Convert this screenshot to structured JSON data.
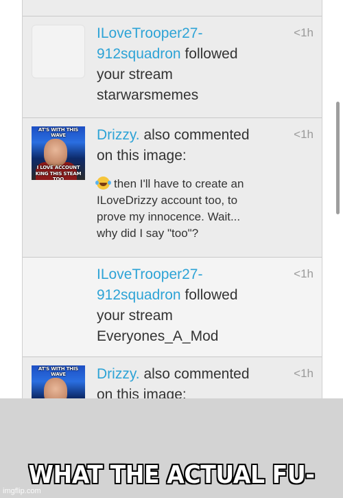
{
  "feed": {
    "items": [
      {
        "type": "follow",
        "user": "ILoveTrooper27-912squadron",
        "user_line1": "ILoveTrooper27-",
        "user_line2": "912squadron",
        "action": "followed",
        "line3": "your stream",
        "stream": "starwarsmemes",
        "time": "<1h",
        "thumbnail": "blank-avatar"
      },
      {
        "type": "comment",
        "user": "Drizzy.",
        "action_line1": "also commented",
        "action_line2": "on this image:",
        "comment_line1": "then I'll have to create an",
        "comment_line2": "ILoveDrizzy account too, to",
        "comment_line3": "prove my innocence. Wait...",
        "comment_line4": "why did I say \"too\"?",
        "emoji": "face-with-tears-of-joy",
        "time": "<1h",
        "thumbnail_caption_top": "AT'S WITH THIS WAVE",
        "thumbnail_caption_bottom1": "I LOVE      ACCOUNT",
        "thumbnail_caption_bottom2": "KING THIS STEAM TOO"
      },
      {
        "type": "follow",
        "user_line1": "ILoveTrooper27-",
        "user_line2": "912squadron",
        "action": "followed",
        "line3": "your stream",
        "stream": "Everyones_A_Mod",
        "time": "<1h"
      },
      {
        "type": "comment",
        "user": "Drizzy.",
        "action_line1": "also commented",
        "action_line2": "on this image:",
        "time": "<1h",
        "thumbnail_caption_top": "AT'S WITH THIS WAVE"
      }
    ]
  },
  "meme": {
    "caption": "WHAT THE ACTUAL FU-",
    "watermark": "imgflip.com"
  },
  "colors": {
    "username": "#2da3d6",
    "text": "#333333",
    "time": "#9a9a9a",
    "feed_bg": "#ececec",
    "bottom_bar": "#d3d3d3"
  }
}
